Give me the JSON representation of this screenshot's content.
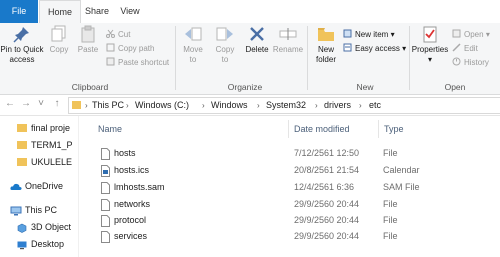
{
  "tabs": {
    "file": "File",
    "home": "Home",
    "share": "Share",
    "view": "View"
  },
  "ribbon": {
    "clipboard": {
      "pin_line1": "Pin to Quick",
      "pin_line2": "access",
      "copy": "Copy",
      "paste": "Paste",
      "cut": "Cut",
      "copy_path": "Copy path",
      "paste_shortcut": "Paste shortcut",
      "label": "Clipboard"
    },
    "organize": {
      "move_to_1": "Move",
      "move_to_2": "to",
      "copy_to_1": "Copy",
      "copy_to_2": "to",
      "delete": "Delete",
      "rename": "Rename",
      "label": "Organize"
    },
    "new": {
      "new_folder_1": "New",
      "new_folder_2": "folder",
      "new_item": "New item",
      "easy_access": "Easy access",
      "label": "New"
    },
    "open": {
      "properties": "Properties",
      "open": "Open",
      "edit": "Edit",
      "history": "History",
      "label": "Open"
    }
  },
  "address": {
    "crumbs": [
      "This PC",
      "Windows (C:)",
      "Windows",
      "System32",
      "drivers",
      "etc"
    ]
  },
  "nav": {
    "items": [
      {
        "label": "final proje",
        "icon": "folder-icon"
      },
      {
        "label": "TERM1_P",
        "icon": "folder-icon"
      },
      {
        "label": "UKULELE",
        "icon": "folder-icon"
      },
      {
        "label": "OneDrive",
        "icon": "cloud-icon"
      },
      {
        "label": "This PC",
        "icon": "computer-icon"
      },
      {
        "label": "3D Object",
        "icon": "cube-icon"
      },
      {
        "label": "Desktop",
        "icon": "desktop-icon"
      }
    ]
  },
  "list": {
    "columns": {
      "name": "Name",
      "date": "Date modified",
      "type": "Type"
    },
    "rows": [
      {
        "name": "hosts",
        "date": "7/12/2561 12:50",
        "type": "File"
      },
      {
        "name": "hosts.ics",
        "date": "20/8/2561 21:54",
        "type": "Calendar"
      },
      {
        "name": "lmhosts.sam",
        "date": "12/4/2561 6:36",
        "type": "SAM File"
      },
      {
        "name": "networks",
        "date": "29/9/2560 20:44",
        "type": "File"
      },
      {
        "name": "protocol",
        "date": "29/9/2560 20:44",
        "type": "File"
      },
      {
        "name": "services",
        "date": "29/9/2560 20:44",
        "type": "File"
      }
    ]
  },
  "colors": {
    "accent": "#1979ca",
    "folder": "#f0c35a",
    "ribbon_bg": "#f5f6f7"
  }
}
